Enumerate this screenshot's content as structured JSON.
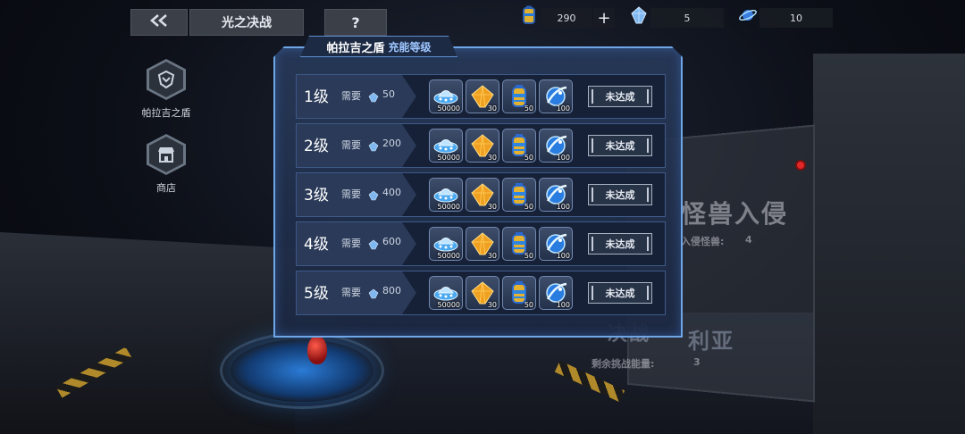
{
  "topbar": {
    "back_icon": "double-chevron-left-icon",
    "title": "光之决战",
    "help": "?",
    "resources": [
      {
        "icon": "energy-battery-icon",
        "value": "290",
        "plus": "+"
      },
      {
        "icon": "crystal-icon",
        "value": "5"
      },
      {
        "icon": "planet-ring-icon",
        "value": "10"
      }
    ]
  },
  "side_menu": [
    {
      "icon": "shield-emblem-icon",
      "label": "帕拉吉之盾"
    },
    {
      "icon": "shop-icon",
      "label": "商店"
    }
  ],
  "dialog": {
    "title": "帕拉吉之盾",
    "subtitle": "充能等级",
    "levels": [
      {
        "name": "1级",
        "req_label": "需要",
        "req_value": "50",
        "rewards": [
          {
            "icon": "ufo-icon",
            "count": "50000"
          },
          {
            "icon": "orange-gem-icon",
            "count": "30"
          },
          {
            "icon": "energy-battery-icon",
            "count": "50"
          },
          {
            "icon": "blue-orb-icon",
            "count": "100"
          }
        ],
        "status": "未达成"
      },
      {
        "name": "2级",
        "req_label": "需要",
        "req_value": "200",
        "rewards": [
          {
            "icon": "ufo-icon",
            "count": "50000"
          },
          {
            "icon": "orange-gem-icon",
            "count": "30"
          },
          {
            "icon": "energy-battery-icon",
            "count": "50"
          },
          {
            "icon": "blue-orb-icon",
            "count": "100"
          }
        ],
        "status": "未达成"
      },
      {
        "name": "3级",
        "req_label": "需要",
        "req_value": "400",
        "rewards": [
          {
            "icon": "ufo-icon",
            "count": "50000"
          },
          {
            "icon": "orange-gem-icon",
            "count": "30"
          },
          {
            "icon": "energy-battery-icon",
            "count": "50"
          },
          {
            "icon": "blue-orb-icon",
            "count": "100"
          }
        ],
        "status": "未达成"
      },
      {
        "name": "4级",
        "req_label": "需要",
        "req_value": "600",
        "rewards": [
          {
            "icon": "ufo-icon",
            "count": "50000"
          },
          {
            "icon": "orange-gem-icon",
            "count": "30"
          },
          {
            "icon": "energy-battery-icon",
            "count": "50"
          },
          {
            "icon": "blue-orb-icon",
            "count": "100"
          }
        ],
        "status": "未达成"
      },
      {
        "name": "5级",
        "req_label": "需要",
        "req_value": "800",
        "rewards": [
          {
            "icon": "ufo-icon",
            "count": "50000"
          },
          {
            "icon": "orange-gem-icon",
            "count": "30"
          },
          {
            "icon": "energy-battery-icon",
            "count": "50"
          },
          {
            "icon": "blue-orb-icon",
            "count": "100"
          }
        ],
        "status": "未达成"
      }
    ]
  },
  "background": {
    "event_title": "怪兽入侵",
    "event_sub_label": "入侵怪兽:",
    "event_sub_value": "4",
    "battle_title": "决战",
    "battle_title_2": "利亚",
    "battle_energy_label": "剩余挑战能量:",
    "battle_energy_value": "3"
  },
  "colors": {
    "dialog_border": "#6ea6e8",
    "row_bg": "#162138",
    "accent_blue": "#9fc7ff"
  }
}
